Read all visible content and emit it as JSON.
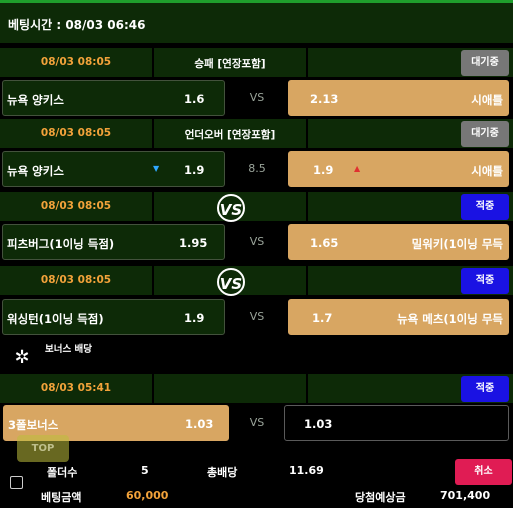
{
  "header": {
    "betting_time": "베팅시간 : 08/03 06:46"
  },
  "matches": [
    {
      "time": "08/03 08:05",
      "market": "승패 [연장포함]",
      "status": "대기중",
      "home": "뉴욕 양키스",
      "home_odds": "1.6",
      "mid": "VS",
      "away_odds": "2.13",
      "away": "시애틀"
    },
    {
      "time": "08/03 08:05",
      "market": "언더오버 [연장포함]",
      "status": "대기중",
      "home": "뉴욕 양키스",
      "home_odds": "1.9",
      "mid": "8.5",
      "away_odds": "1.9",
      "away": "시애틀"
    },
    {
      "time": "08/03 08:05",
      "market": "",
      "status": "적중",
      "home": "피츠버그(1이닝 득점)",
      "home_odds": "1.95",
      "mid": "VS",
      "away_odds": "1.65",
      "away": "밀워키(1이닝 무득"
    },
    {
      "time": "08/03 08:05",
      "market": "",
      "status": "적중",
      "home": "워싱턴(1이닝 득점)",
      "home_odds": "1.9",
      "mid": "VS",
      "away_odds": "1.7",
      "away": "뉴욕 메츠(1이닝 무득"
    }
  ],
  "bonus": {
    "section_label": "보너스 배당",
    "time": "08/03 05:41",
    "status": "적중",
    "name": "3폴보너스",
    "odds": "1.03",
    "mid": "VS",
    "right_odds": "1.03"
  },
  "footer": {
    "top_label": "TOP",
    "folders_label": "폴더수",
    "folders_value": "5",
    "total_odds_label": "총배당",
    "total_odds_value": "11.69",
    "cancel_label": "취소",
    "bet_amount_label": "베팅금액",
    "bet_amount_value": "60,000",
    "expected_label": "당첨예상금",
    "expected_value": "701,400"
  },
  "colors": {
    "accent_orange": "#f2a23a",
    "selected_bg": "#d8a662",
    "hit_blue": "#1a12e3",
    "cancel_red": "#e01c54"
  }
}
